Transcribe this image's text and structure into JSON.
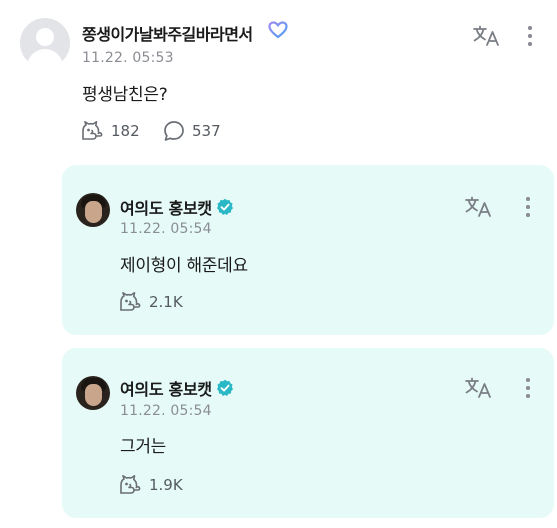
{
  "post": {
    "nickname": "쫑생이가날봐주길바라면서",
    "time": "11.22. 05:53",
    "text": "평생남친은?",
    "likes": "182",
    "comments": "537"
  },
  "replies": [
    {
      "nickname": "여의도 홍보캣",
      "time": "11.22. 05:54",
      "text": "제이형이 해준데요",
      "likes": "2.1K"
    },
    {
      "nickname": "여의도 홍보캣",
      "time": "11.22. 05:54",
      "text": "그거는",
      "likes": "1.9K"
    }
  ],
  "icons": {
    "translate": "translate-icon",
    "more": "more-vertical-icon",
    "like": "cat-paw-like-icon",
    "comment": "speech-bubble-icon",
    "verified": "verified-badge-icon",
    "heart": "heart-outline-icon"
  },
  "colors": {
    "reply_background": "#e6fbf8",
    "verified_badge": "#2bb8c6",
    "muted_text": "#8a8d93"
  }
}
